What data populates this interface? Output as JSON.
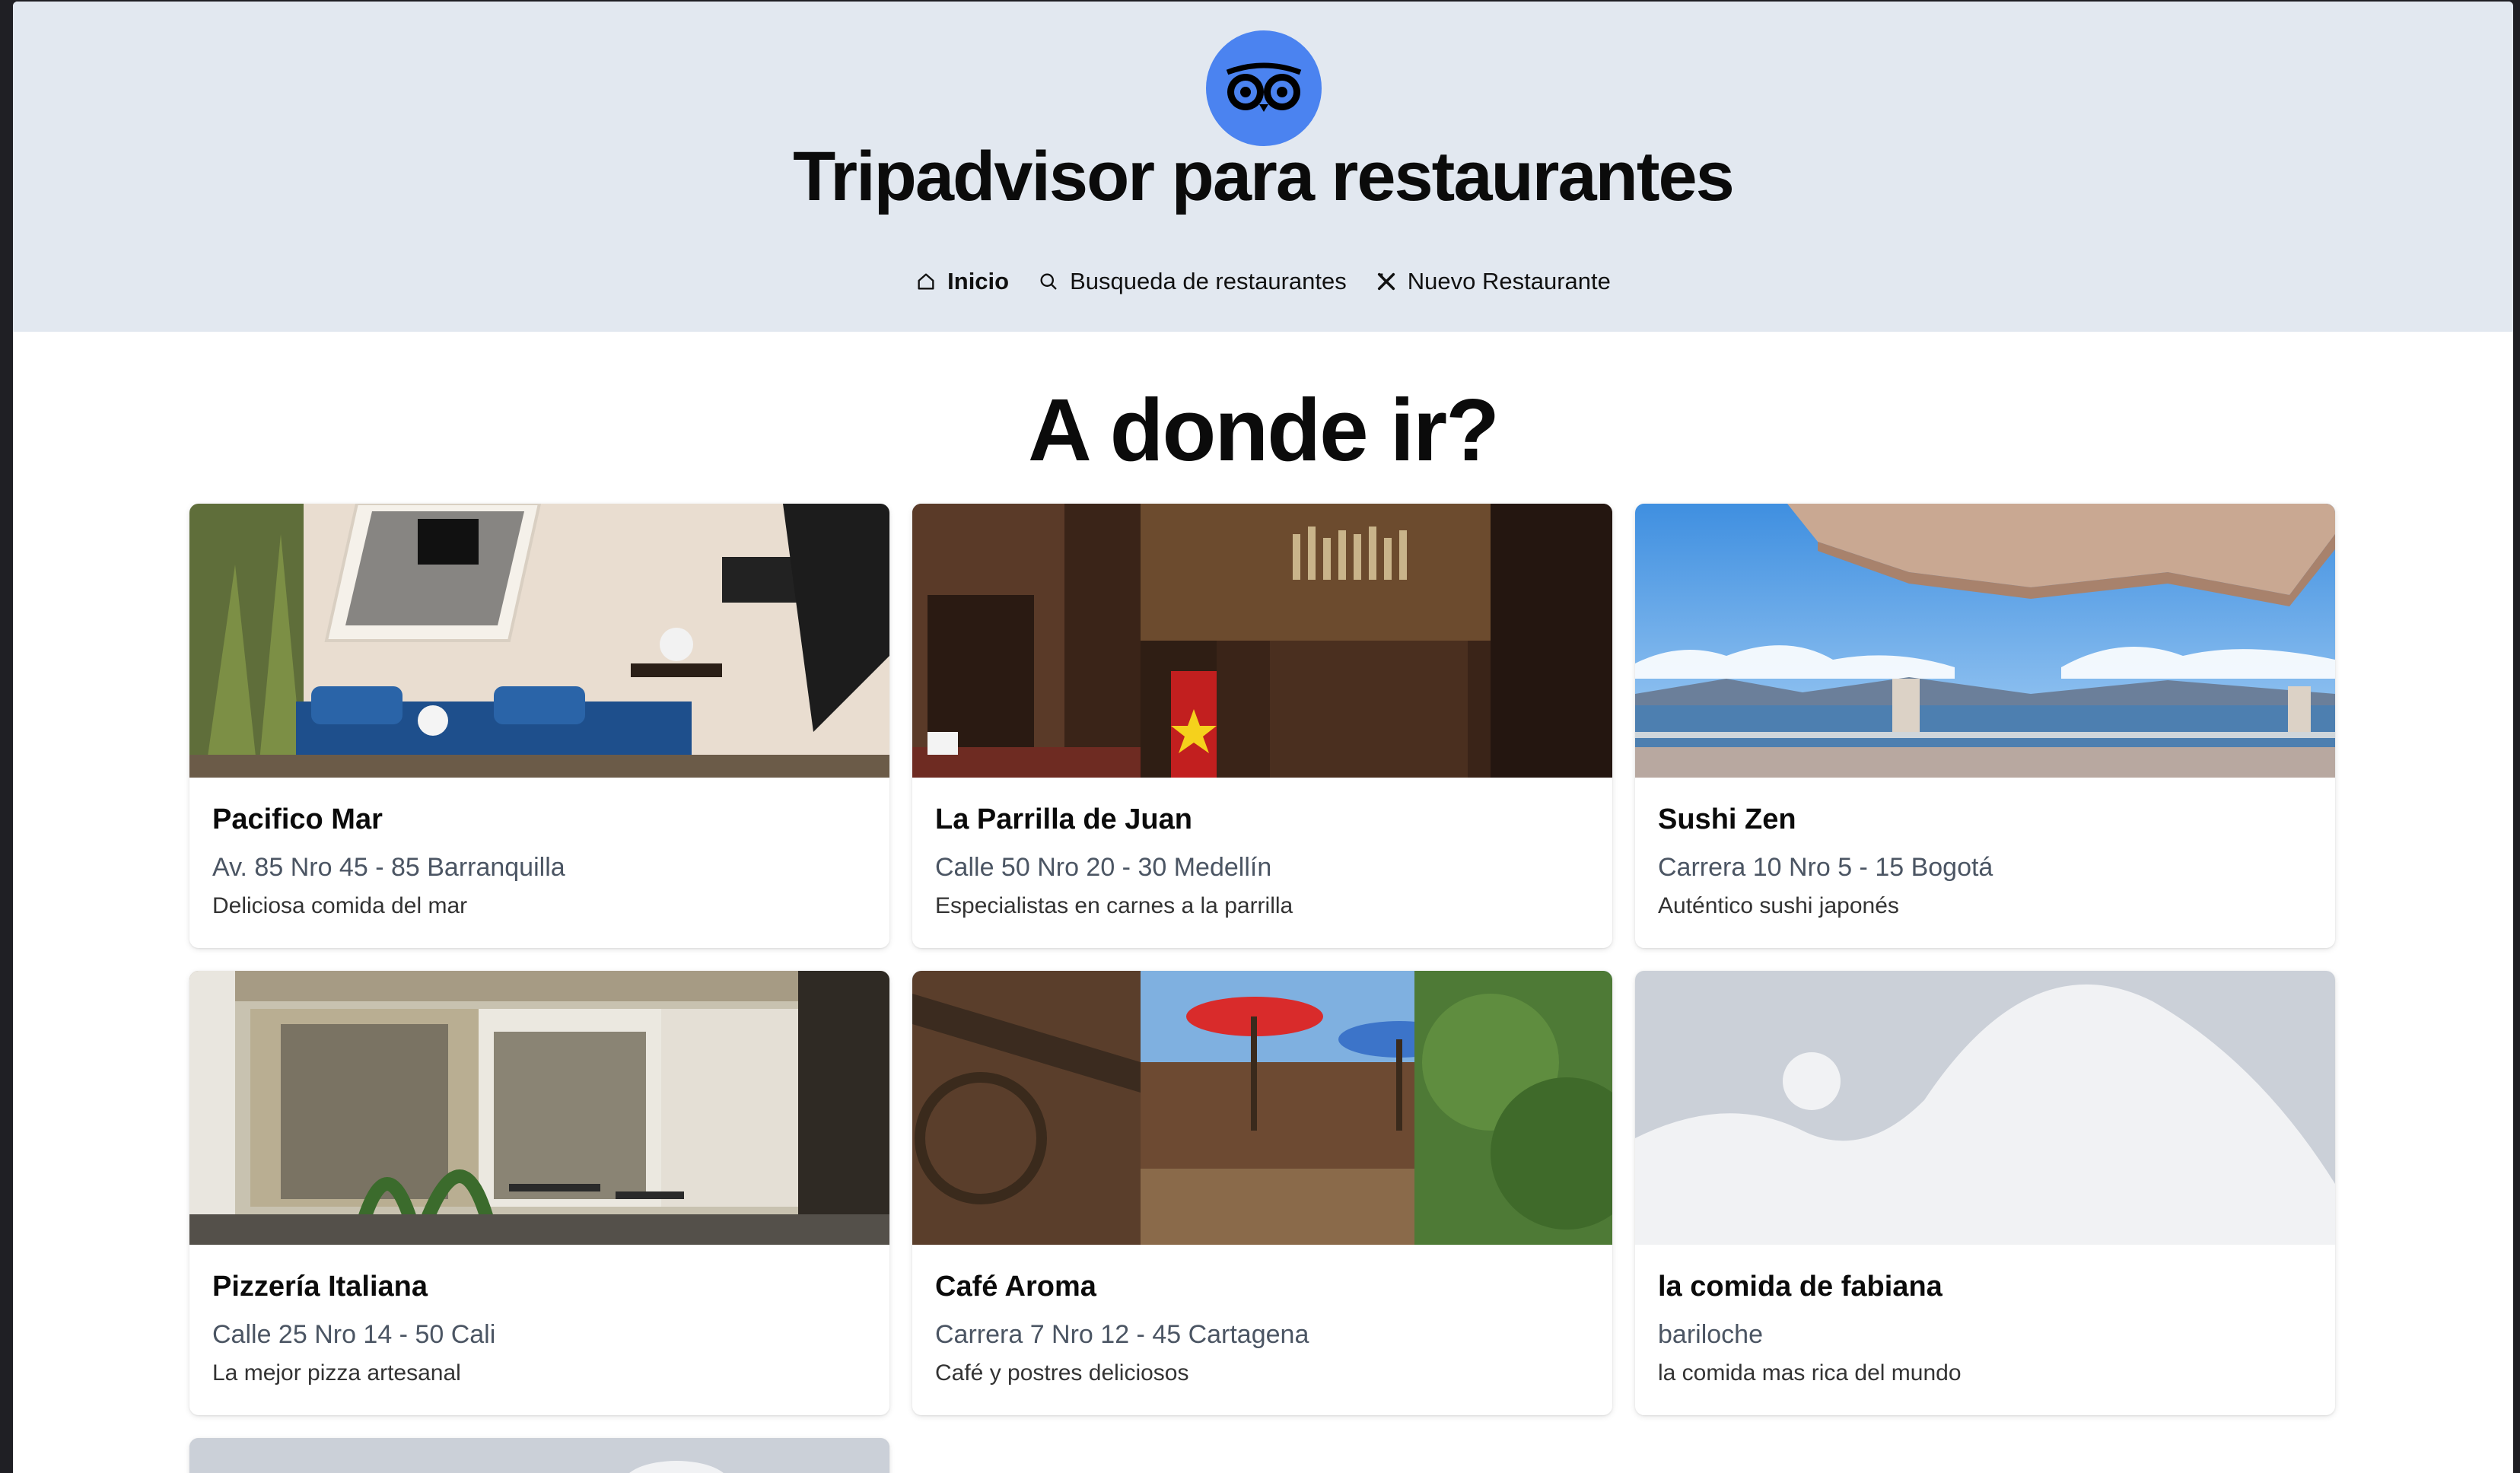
{
  "app": {
    "title": "Tripadvisor para restaurantes",
    "logo_icon": "tripadvisor-owl-icon",
    "accent": "#4b83f0"
  },
  "nav": {
    "items": [
      {
        "label": "Inicio",
        "icon": "home-icon",
        "active": true
      },
      {
        "label": "Busqueda de restaurantes",
        "icon": "search-icon",
        "active": false
      },
      {
        "label": "Nuevo Restaurante",
        "icon": "utensils-icon",
        "active": false
      }
    ]
  },
  "main": {
    "heading": "A donde ir?",
    "restaurants": [
      {
        "name": "Pacifico Mar",
        "address": "Av. 85 Nro 45 - 85 Barranquilla",
        "description": "Deliciosa comida del mar",
        "image": "lounge-photo"
      },
      {
        "name": "La Parrilla de Juan",
        "address": "Calle 50 Nro 20 - 30 Medellín",
        "description": "Especialistas en carnes a la parrilla",
        "image": "bar-photo"
      },
      {
        "name": "Sushi Zen",
        "address": "Carrera 10 Nro 5 - 15 Bogotá",
        "description": "Auténtico sushi japonés",
        "image": "terrace-photo"
      },
      {
        "name": "Pizzería Italiana",
        "address": "Calle 25 Nro 14 - 50 Cali",
        "description": "La mejor pizza artesanal",
        "image": "storefront-photo"
      },
      {
        "name": "Café Aroma",
        "address": "Carrera 7 Nro 12 - 45 Cartagena",
        "description": "Café y postres deliciosos",
        "image": "cabin-photo"
      },
      {
        "name": "la comida de fabiana",
        "address": "bariloche",
        "description": "la comida mas rica del mundo",
        "image": "placeholder-image"
      }
    ]
  }
}
